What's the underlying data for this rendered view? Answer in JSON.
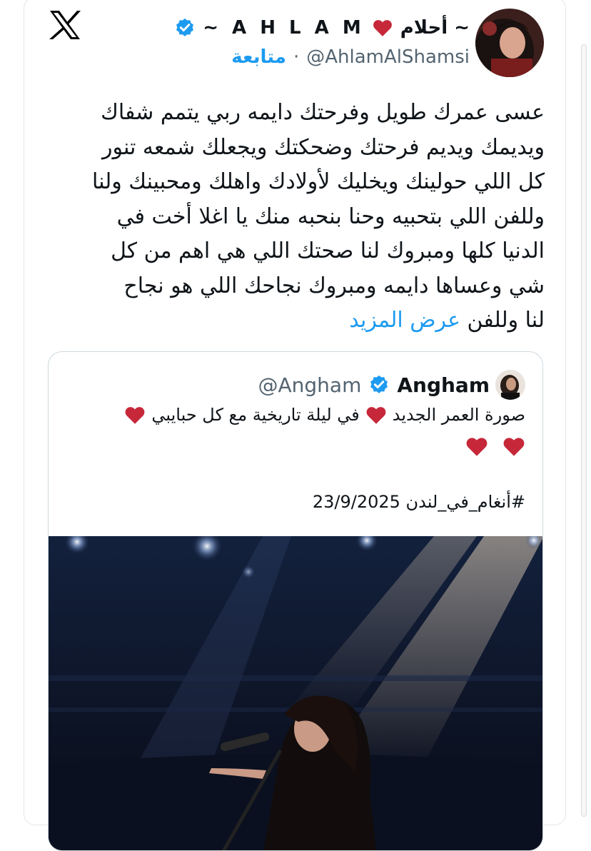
{
  "tweet": {
    "author": {
      "name_arabic": "أحلام ~",
      "name_latin": "~ A H L A M",
      "handle": "@AhlamAlShamsi",
      "follow_label": "متابعة",
      "separator": "·"
    },
    "text_lines": [
      "عسى عمرك طويل وفرحتك دايمه ربي يتمم شفاك",
      "ويديمك ويديم فرحتك وضحكتك ويجعلك شمعه تنور",
      "كل اللي حولينك ويخليك لأولادك واهلك ومحبينك ولنا",
      "وللفن اللي بتحبيه وحنا بنحبه منك يا اغلا أخت في",
      "الدنيا كلها ومبروك لنا صحتك اللي هي اهم من كل",
      "شي وعساها دايمه ومبروك نجاحك اللي هو نجاح",
      "لنا وللفن"
    ],
    "show_more_label": "عرض المزيد"
  },
  "quoted": {
    "name": "Angham",
    "handle": "@Angham",
    "line1_a": "صورة العمر الجديد",
    "line1_b": "في ليلة تاريخية مع كل حبايبي",
    "hashtag_line": "#أنغام_في_لندن 23/9/2025"
  },
  "colors": {
    "accent": "#1d9bf0",
    "heart": "#c6283a",
    "text": "#0f1419",
    "muted": "#536471"
  },
  "icons": [
    "x-logo-icon",
    "verified-badge-icon",
    "heart-icon"
  ]
}
